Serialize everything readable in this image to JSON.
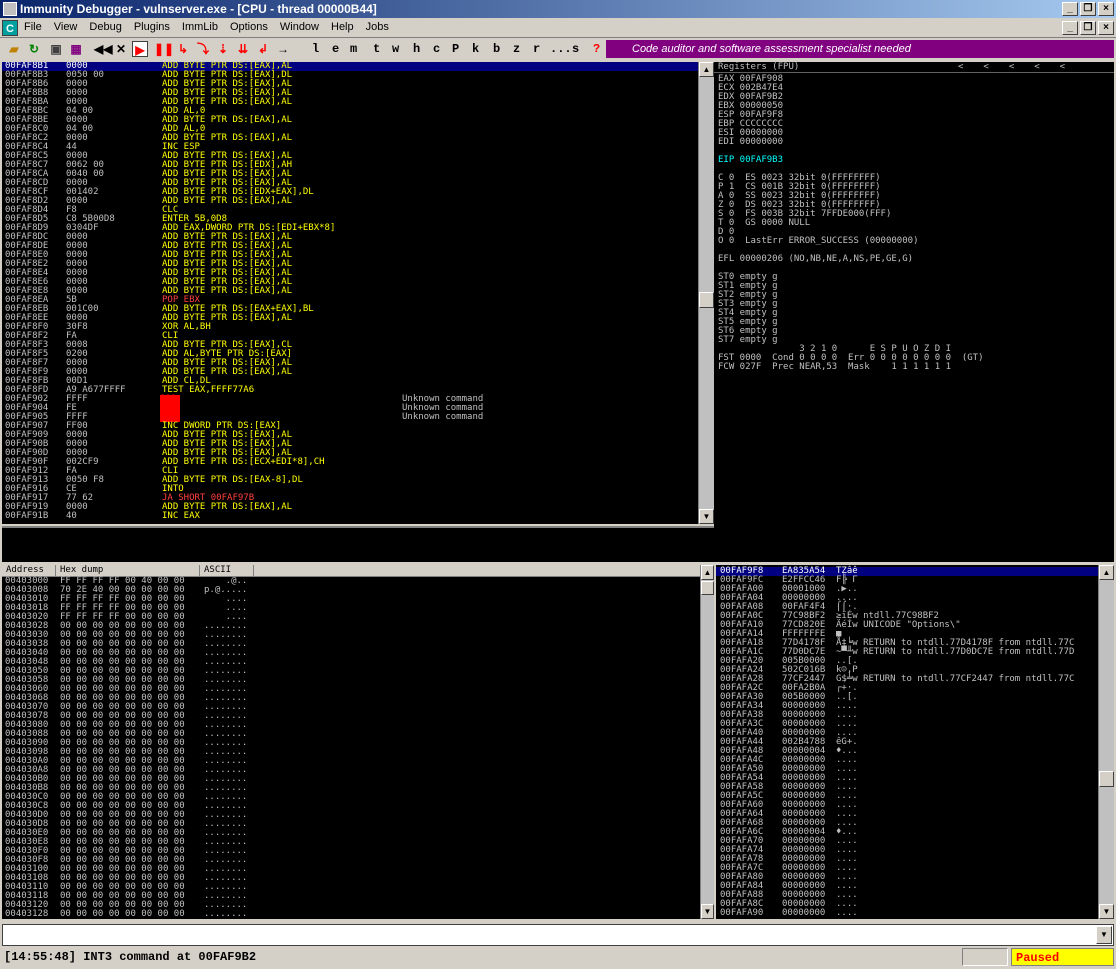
{
  "window": {
    "title": "Immunity Debugger - vulnserver.exe - [CPU - thread 00000B44]"
  },
  "menu": [
    "File",
    "View",
    "Debug",
    "Plugins",
    "ImmLib",
    "Options",
    "Window",
    "Help",
    "Jobs"
  ],
  "toolbar": {
    "letters": [
      "l",
      "e",
      "m",
      "t",
      "w",
      "h",
      "c",
      "P",
      "k",
      "b",
      "z",
      "r",
      "...",
      "s",
      "?"
    ],
    "banner": "Code auditor and software assessment specialist needed"
  },
  "disasm": [
    {
      "a": "00FAF8B1",
      "h": "0000",
      "i": "ADD BYTE PTR DS:[EAX],AL",
      "c": "",
      "t": "add",
      "sel": true
    },
    {
      "a": "00FAF8B3",
      "h": "0050 00",
      "i": "ADD BYTE PTR DS:[EAX],DL",
      "c": "",
      "t": "add"
    },
    {
      "a": "00FAF8B6",
      "h": "0000",
      "i": "ADD BYTE PTR DS:[EAX],AL",
      "c": "",
      "t": "add"
    },
    {
      "a": "00FAF8B8",
      "h": "0000",
      "i": "ADD BYTE PTR DS:[EAX],AL",
      "c": "",
      "t": "add"
    },
    {
      "a": "00FAF8BA",
      "h": "0000",
      "i": "ADD BYTE PTR DS:[EAX],AL",
      "c": "",
      "t": "add"
    },
    {
      "a": "00FAF8BC",
      "h": "04 00",
      "i": "ADD AL,0",
      "c": "",
      "t": "add"
    },
    {
      "a": "00FAF8BE",
      "h": "0000",
      "i": "ADD BYTE PTR DS:[EAX],AL",
      "c": "",
      "t": "add"
    },
    {
      "a": "00FAF8C0",
      "h": "04 00",
      "i": "ADD AL,0",
      "c": "",
      "t": "add"
    },
    {
      "a": "00FAF8C2",
      "h": "0000",
      "i": "ADD BYTE PTR DS:[EAX],AL",
      "c": "",
      "t": "add"
    },
    {
      "a": "00FAF8C4",
      "h": "44",
      "i": "INC ESP",
      "c": "",
      "t": "inc"
    },
    {
      "a": "00FAF8C5",
      "h": "0000",
      "i": "ADD BYTE PTR DS:[EAX],AL",
      "c": "",
      "t": "add"
    },
    {
      "a": "00FAF8C7",
      "h": "0062 00",
      "i": "ADD BYTE PTR DS:[EDX],AH",
      "c": "",
      "t": "add"
    },
    {
      "a": "00FAF8CA",
      "h": "0040 00",
      "i": "ADD BYTE PTR DS:[EAX],AL",
      "c": "",
      "t": "add"
    },
    {
      "a": "00FAF8CD",
      "h": "0000",
      "i": "ADD BYTE PTR DS:[EAX],AL",
      "c": "",
      "t": "add"
    },
    {
      "a": "00FAF8CF",
      "h": "001402",
      "i": "ADD BYTE PTR DS:[EDX+EAX],DL",
      "c": "",
      "t": "add"
    },
    {
      "a": "00FAF8D2",
      "h": "0000",
      "i": "ADD BYTE PTR DS:[EAX],AL",
      "c": "",
      "t": "add"
    },
    {
      "a": "00FAF8D4",
      "h": "F8",
      "i": "CLC",
      "c": "",
      "t": "add"
    },
    {
      "a": "00FAF8D5",
      "h": "C8 5B00D8",
      "i": "ENTER 5B,0D8",
      "c": "",
      "t": "add"
    },
    {
      "a": "00FAF8D9",
      "h": "0304DF",
      "i": "ADD EAX,DWORD PTR DS:[EDI+EBX*8]",
      "c": "",
      "t": "add"
    },
    {
      "a": "00FAF8DC",
      "h": "0000",
      "i": "ADD BYTE PTR DS:[EAX],AL",
      "c": "",
      "t": "add"
    },
    {
      "a": "00FAF8DE",
      "h": "0000",
      "i": "ADD BYTE PTR DS:[EAX],AL",
      "c": "",
      "t": "add"
    },
    {
      "a": "00FAF8E0",
      "h": "0000",
      "i": "ADD BYTE PTR DS:[EAX],AL",
      "c": "",
      "t": "add"
    },
    {
      "a": "00FAF8E2",
      "h": "0000",
      "i": "ADD BYTE PTR DS:[EAX],AL",
      "c": "",
      "t": "add"
    },
    {
      "a": "00FAF8E4",
      "h": "0000",
      "i": "ADD BYTE PTR DS:[EAX],AL",
      "c": "",
      "t": "add"
    },
    {
      "a": "00FAF8E6",
      "h": "0000",
      "i": "ADD BYTE PTR DS:[EAX],AL",
      "c": "",
      "t": "add"
    },
    {
      "a": "00FAF8E8",
      "h": "0000",
      "i": "ADD BYTE PTR DS:[EAX],AL",
      "c": "",
      "t": "add"
    },
    {
      "a": "00FAF8EA",
      "h": "5B",
      "i": "POP EBX",
      "c": "",
      "t": "pop"
    },
    {
      "a": "00FAF8EB",
      "h": "001C00",
      "i": "ADD BYTE PTR DS:[EAX+EAX],BL",
      "c": "",
      "t": "add"
    },
    {
      "a": "00FAF8EE",
      "h": "0000",
      "i": "ADD BYTE PTR DS:[EAX],AL",
      "c": "",
      "t": "add"
    },
    {
      "a": "00FAF8F0",
      "h": "30F8",
      "i": "XOR AL,BH",
      "c": "",
      "t": "add"
    },
    {
      "a": "00FAF8F2",
      "h": "FA",
      "i": "CLI",
      "c": "",
      "t": "add"
    },
    {
      "a": "00FAF8F3",
      "h": "0008",
      "i": "ADD BYTE PTR DS:[EAX],CL",
      "c": "",
      "t": "add"
    },
    {
      "a": "00FAF8F5",
      "h": "0200",
      "i": "ADD AL,BYTE PTR DS:[EAX]",
      "c": "",
      "t": "add"
    },
    {
      "a": "00FAF8F7",
      "h": "0000",
      "i": "ADD BYTE PTR DS:[EAX],AL",
      "c": "",
      "t": "add"
    },
    {
      "a": "00FAF8F9",
      "h": "0000",
      "i": "ADD BYTE PTR DS:[EAX],AL",
      "c": "",
      "t": "add"
    },
    {
      "a": "00FAF8FB",
      "h": "00D1",
      "i": "ADD CL,DL",
      "c": "",
      "t": "add"
    },
    {
      "a": "00FAF8FD",
      "h": "A9 A677FFFF",
      "i": "TEST EAX,FFFF77A6",
      "c": "",
      "t": "test"
    },
    {
      "a": "00FAF902",
      "h": "FFFF",
      "i": "???",
      "c": "Unknown command",
      "t": "bad"
    },
    {
      "a": "00FAF904",
      "h": "FE",
      "i": "???",
      "c": "Unknown command",
      "t": "bad"
    },
    {
      "a": "00FAF905",
      "h": "FFFF",
      "i": "???",
      "c": "Unknown command",
      "t": "bad"
    },
    {
      "a": "00FAF907",
      "h": "FF00",
      "i": "INC DWORD PTR DS:[EAX]",
      "c": "",
      "t": "inc"
    },
    {
      "a": "00FAF909",
      "h": "0000",
      "i": "ADD BYTE PTR DS:[EAX],AL",
      "c": "",
      "t": "add"
    },
    {
      "a": "00FAF90B",
      "h": "0000",
      "i": "ADD BYTE PTR DS:[EAX],AL",
      "c": "",
      "t": "add"
    },
    {
      "a": "00FAF90D",
      "h": "0000",
      "i": "ADD BYTE PTR DS:[EAX],AL",
      "c": "",
      "t": "add"
    },
    {
      "a": "00FAF90F",
      "h": "002CF9",
      "i": "ADD BYTE PTR DS:[ECX+EDI*8],CH",
      "c": "",
      "t": "add"
    },
    {
      "a": "00FAF912",
      "h": "FA",
      "i": "CLI",
      "c": "",
      "t": "add"
    },
    {
      "a": "00FAF913",
      "h": "0050 F8",
      "i": "ADD BYTE PTR DS:[EAX-8],DL",
      "c": "",
      "t": "add"
    },
    {
      "a": "00FAF916",
      "h": "CE",
      "i": "INTO",
      "c": "",
      "t": "add"
    },
    {
      "a": "00FAF917",
      "h": "77 62",
      "i": "JA SHORT 00FAF97B",
      "c": "",
      "t": "ja"
    },
    {
      "a": "00FAF919",
      "h": "0000",
      "i": "ADD BYTE PTR DS:[EAX],AL",
      "c": "",
      "t": "add"
    },
    {
      "a": "00FAF91B",
      "h": "40",
      "i": "INC EAX",
      "c": "",
      "t": "inc"
    }
  ],
  "registers": {
    "header": "Registers (FPU)",
    "lines": [
      "EAX 00FAF908",
      "ECX 002B47E4",
      "EDX 00FAF9B2",
      "EBX 00000050",
      "ESP 00FAF9F8",
      "EBP CCCCCCCC",
      "ESI 00000000",
      "EDI 00000000",
      "",
      "EIP 00FAF9B3",
      "",
      "C 0  ES 0023 32bit 0(FFFFFFFF)",
      "P 1  CS 001B 32bit 0(FFFFFFFF)",
      "A 0  SS 0023 32bit 0(FFFFFFFF)",
      "Z 0  DS 0023 32bit 0(FFFFFFFF)",
      "S 0  FS 003B 32bit 7FFDE000(FFF)",
      "T 0  GS 0000 NULL",
      "D 0",
      "O 0  LastErr ERROR_SUCCESS (00000000)",
      "",
      "EFL 00000206 (NO,NB,NE,A,NS,PE,GE,G)",
      "",
      "ST0 empty g",
      "ST1 empty g",
      "ST2 empty g",
      "ST3 empty g",
      "ST4 empty g",
      "ST5 empty g",
      "ST6 empty g",
      "ST7 empty g",
      "               3 2 1 0      E S P U O Z D I",
      "FST 0000  Cond 0 0 0 0  Err 0 0 0 0 0 0 0 0  (GT)",
      "FCW 027F  Prec NEAR,53  Mask    1 1 1 1 1 1"
    ]
  },
  "dump": {
    "headers": [
      "Address",
      "Hex dump",
      "ASCII"
    ],
    "rows": [
      {
        "a": "00403000",
        "h": "FF FF FF FF 00 40 00 00",
        "s": "    .@.."
      },
      {
        "a": "00403008",
        "h": "70 2E 40 00 00 00 00 00",
        "s": "p.@....."
      },
      {
        "a": "00403010",
        "h": "FF FF FF FF 00 00 00 00",
        "s": "    ...."
      },
      {
        "a": "00403018",
        "h": "FF FF FF FF 00 00 00 00",
        "s": "    ...."
      },
      {
        "a": "00403020",
        "h": "FF FF FF FF 00 00 00 00",
        "s": "    ...."
      },
      {
        "a": "00403028",
        "h": "00 00 00 00 00 00 00 00",
        "s": "........"
      },
      {
        "a": "00403030",
        "h": "00 00 00 00 00 00 00 00",
        "s": "........"
      },
      {
        "a": "00403038",
        "h": "00 00 00 00 00 00 00 00",
        "s": "........"
      },
      {
        "a": "00403040",
        "h": "00 00 00 00 00 00 00 00",
        "s": "........"
      },
      {
        "a": "00403048",
        "h": "00 00 00 00 00 00 00 00",
        "s": "........"
      },
      {
        "a": "00403050",
        "h": "00 00 00 00 00 00 00 00",
        "s": "........"
      },
      {
        "a": "00403058",
        "h": "00 00 00 00 00 00 00 00",
        "s": "........"
      },
      {
        "a": "00403060",
        "h": "00 00 00 00 00 00 00 00",
        "s": "........"
      },
      {
        "a": "00403068",
        "h": "00 00 00 00 00 00 00 00",
        "s": "........"
      },
      {
        "a": "00403070",
        "h": "00 00 00 00 00 00 00 00",
        "s": "........"
      },
      {
        "a": "00403078",
        "h": "00 00 00 00 00 00 00 00",
        "s": "........"
      },
      {
        "a": "00403080",
        "h": "00 00 00 00 00 00 00 00",
        "s": "........"
      },
      {
        "a": "00403088",
        "h": "00 00 00 00 00 00 00 00",
        "s": "........"
      },
      {
        "a": "00403090",
        "h": "00 00 00 00 00 00 00 00",
        "s": "........"
      },
      {
        "a": "00403098",
        "h": "00 00 00 00 00 00 00 00",
        "s": "........"
      },
      {
        "a": "004030A0",
        "h": "00 00 00 00 00 00 00 00",
        "s": "........"
      },
      {
        "a": "004030A8",
        "h": "00 00 00 00 00 00 00 00",
        "s": "........"
      },
      {
        "a": "004030B0",
        "h": "00 00 00 00 00 00 00 00",
        "s": "........"
      },
      {
        "a": "004030B8",
        "h": "00 00 00 00 00 00 00 00",
        "s": "........"
      },
      {
        "a": "004030C0",
        "h": "00 00 00 00 00 00 00 00",
        "s": "........"
      },
      {
        "a": "004030C8",
        "h": "00 00 00 00 00 00 00 00",
        "s": "........"
      },
      {
        "a": "004030D0",
        "h": "00 00 00 00 00 00 00 00",
        "s": "........"
      },
      {
        "a": "004030D8",
        "h": "00 00 00 00 00 00 00 00",
        "s": "........"
      },
      {
        "a": "004030E0",
        "h": "00 00 00 00 00 00 00 00",
        "s": "........"
      },
      {
        "a": "004030E8",
        "h": "00 00 00 00 00 00 00 00",
        "s": "........"
      },
      {
        "a": "004030F0",
        "h": "00 00 00 00 00 00 00 00",
        "s": "........"
      },
      {
        "a": "004030F8",
        "h": "00 00 00 00 00 00 00 00",
        "s": "........"
      },
      {
        "a": "00403100",
        "h": "00 00 00 00 00 00 00 00",
        "s": "........"
      },
      {
        "a": "00403108",
        "h": "00 00 00 00 00 00 00 00",
        "s": "........"
      },
      {
        "a": "00403110",
        "h": "00 00 00 00 00 00 00 00",
        "s": "........"
      },
      {
        "a": "00403118",
        "h": "00 00 00 00 00 00 00 00",
        "s": "........"
      },
      {
        "a": "00403120",
        "h": "00 00 00 00 00 00 00 00",
        "s": "........"
      },
      {
        "a": "00403128",
        "h": "00 00 00 00 00 00 00 00",
        "s": "........"
      }
    ]
  },
  "stack": {
    "rows": [
      {
        "a": "00FAF9F8",
        "v": "EA835A54",
        "c": "TZâê",
        "sel": true
      },
      {
        "a": "00FAF9FC",
        "v": "E2FFCC46",
        "c": "F╠ Γ"
      },
      {
        "a": "00FAFA00",
        "v": "00001000",
        "c": ".▶.."
      },
      {
        "a": "00FAFA04",
        "v": "00000000",
        "c": "...."
      },
      {
        "a": "00FAFA08",
        "v": "00FAF4F4",
        "c": "⌠⌠·."
      },
      {
        "a": "00FAFA0C",
        "v": "77C98BF2",
        "c": "≥ïÉw ntdll.77C98BF2"
      },
      {
        "a": "00FAFA10",
        "v": "77CD820E",
        "c": "ÄéÍw UNICODE \"Options\\\""
      },
      {
        "a": "00FAFA14",
        "v": "FFFFFFFE",
        "c": "■   "
      },
      {
        "a": "00FAFA18",
        "v": "77D4178F",
        "c": "Å‡╘w RETURN to ntdll.77D4178F from ntdll.77C"
      },
      {
        "a": "00FAFA1C",
        "v": "77D0DC7E",
        "c": "~▀╨w RETURN to ntdll.77D0DC7E from ntdll.77D"
      },
      {
        "a": "00FAFA20",
        "v": "005B0000",
        "c": "..[."
      },
      {
        "a": "00FAFA24",
        "v": "502C016B",
        "c": "k☺,P"
      },
      {
        "a": "00FAFA28",
        "v": "77CF2447",
        "c": "G$╧w RETURN to ntdll.77CF2447 from ntdll.77C"
      },
      {
        "a": "00FAFA2C",
        "v": "00FA2B0A",
        "c": "┌+·."
      },
      {
        "a": "00FAFA30",
        "v": "005B0000",
        "c": "..[."
      },
      {
        "a": "00FAFA34",
        "v": "00000000",
        "c": "...."
      },
      {
        "a": "00FAFA38",
        "v": "00000000",
        "c": "...."
      },
      {
        "a": "00FAFA3C",
        "v": "00000000",
        "c": "...."
      },
      {
        "a": "00FAFA40",
        "v": "00000000",
        "c": "...."
      },
      {
        "a": "00FAFA44",
        "v": "002B4788",
        "c": "êG+."
      },
      {
        "a": "00FAFA48",
        "v": "00000004",
        "c": "♦..."
      },
      {
        "a": "00FAFA4C",
        "v": "00000000",
        "c": "...."
      },
      {
        "a": "00FAFA50",
        "v": "00000000",
        "c": "...."
      },
      {
        "a": "00FAFA54",
        "v": "00000000",
        "c": "...."
      },
      {
        "a": "00FAFA58",
        "v": "00000000",
        "c": "...."
      },
      {
        "a": "00FAFA5C",
        "v": "00000000",
        "c": "...."
      },
      {
        "a": "00FAFA60",
        "v": "00000000",
        "c": "...."
      },
      {
        "a": "00FAFA64",
        "v": "00000000",
        "c": "...."
      },
      {
        "a": "00FAFA68",
        "v": "00000000",
        "c": "...."
      },
      {
        "a": "00FAFA6C",
        "v": "00000004",
        "c": "♦..."
      },
      {
        "a": "00FAFA70",
        "v": "00000000",
        "c": "...."
      },
      {
        "a": "00FAFA74",
        "v": "00000000",
        "c": "...."
      },
      {
        "a": "00FAFA78",
        "v": "00000000",
        "c": "...."
      },
      {
        "a": "00FAFA7C",
        "v": "00000000",
        "c": "...."
      },
      {
        "a": "00FAFA80",
        "v": "00000000",
        "c": "...."
      },
      {
        "a": "00FAFA84",
        "v": "00000000",
        "c": "...."
      },
      {
        "a": "00FAFA88",
        "v": "00000000",
        "c": "...."
      },
      {
        "a": "00FAFA8C",
        "v": "00000000",
        "c": "...."
      },
      {
        "a": "00FAFA90",
        "v": "00000000",
        "c": "...."
      }
    ]
  },
  "command": {
    "value": ""
  },
  "status": {
    "message": "[14:55:48] INT3 command at 00FAF9B2",
    "state": "Paused"
  },
  "colors": {
    "add": "#ffff00",
    "inc": "#ffff00",
    "test": "#ffff00",
    "pop": "#ff4040",
    "ja": "#ff4040",
    "bad": "#ff0000",
    "address": "#00ffff",
    "selected": "#000080"
  }
}
